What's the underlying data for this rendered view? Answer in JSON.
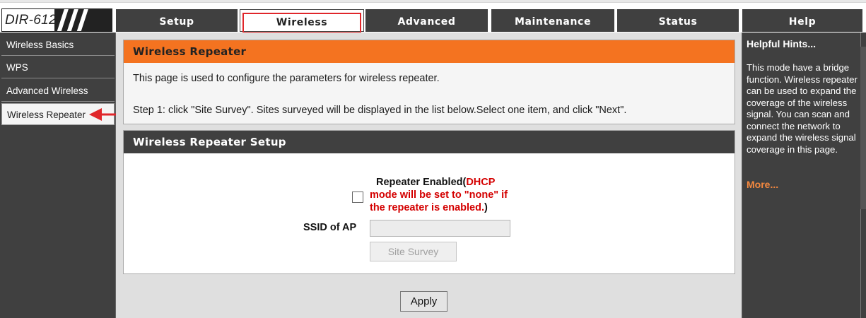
{
  "logo": {
    "text": "DIR-612"
  },
  "nav": {
    "tabs": [
      {
        "label": "Setup"
      },
      {
        "label": "Wireless",
        "active": true
      },
      {
        "label": "Advanced"
      },
      {
        "label": "Maintenance"
      },
      {
        "label": "Status"
      },
      {
        "label": "Help"
      }
    ]
  },
  "sidebar": {
    "items": [
      {
        "label": "Wireless Basics"
      },
      {
        "label": "WPS"
      },
      {
        "label": "Advanced Wireless"
      },
      {
        "label": "Wireless Repeater",
        "active": true
      }
    ]
  },
  "intro": {
    "title": "Wireless Repeater",
    "line1": "This page is used to configure the parameters for wireless repeater.",
    "line2": "Step 1: click \"Site Survey\". Sites surveyed will be displayed in the list below.Select one item, and click \"Next\"."
  },
  "setup": {
    "title": "Wireless Repeater Setup",
    "repeater_label": "Repeater Enabled(",
    "repeater_warn_1": "DHCP",
    "repeater_warn_2": "mode will be set to \"none\" if",
    "repeater_warn_3": "the repeater is enabled.",
    "repeater_close": ")",
    "repeater_enabled": false,
    "ssid_label": "SSID of AP",
    "ssid_value": "",
    "site_survey_label": "Site Survey"
  },
  "apply_label": "Apply",
  "hints": {
    "title": "Helpful Hints...",
    "text": "This mode have a bridge function. Wireless repeater can be used to expand the coverage of the wireless signal. You can scan and connect the network to expand the wireless signal coverage in this page.",
    "more": "More..."
  },
  "colors": {
    "nav_bg": "#404040",
    "accent_orange": "#f47320",
    "highlight_red": "#e0262a",
    "warning_red": "#d40000",
    "more_link": "#f4883f"
  },
  "icons": {
    "logo_mark": "diagonal-stripes",
    "pointer": "red-arrow"
  }
}
